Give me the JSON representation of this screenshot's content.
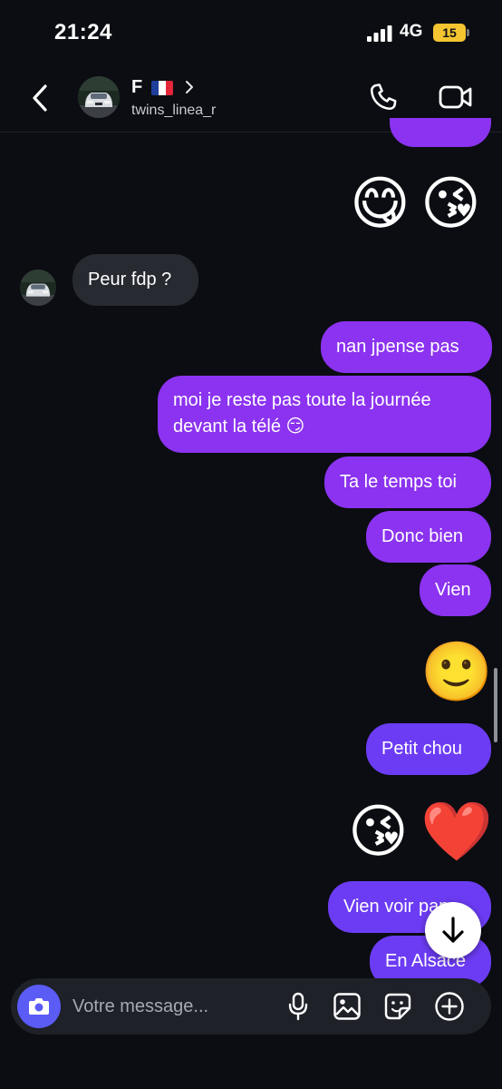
{
  "status_bar": {
    "time": "21:24",
    "network": "4G",
    "battery": "15"
  },
  "header": {
    "name": "F",
    "handle": "twins_linea_r"
  },
  "messages": {
    "m1": "Peur fdp ?",
    "m2": "nan jpense pas",
    "m3_line1": "moi je reste pas toute la journée",
    "m3_line2": "devant la télé",
    "m4": "Ta le temps toi",
    "m5": "Donc bien",
    "m6": "Vien",
    "m7": "Petit chou",
    "m8": "Vien voir p",
    "m8_hidden": "apa",
    "m9": "En Alsace"
  },
  "emojis": {
    "top": [
      "😋",
      "😘"
    ],
    "mid": "🙂",
    "inline": "😏",
    "bottom": [
      "😘",
      "❤️"
    ]
  },
  "composer": {
    "placeholder": "Votre message..."
  },
  "colors": {
    "outgoing": "#8b33f0",
    "outgoing_recent": "#6c3cf4",
    "incoming": "#272a31",
    "camera": "#5b5cf6",
    "battery": "#f4c531"
  },
  "icons": [
    "back-icon",
    "chevron-right-icon",
    "phone-icon",
    "video-icon",
    "camera-icon",
    "microphone-icon",
    "image-icon",
    "sticker-icon",
    "plus-icon",
    "arrow-down-icon"
  ]
}
